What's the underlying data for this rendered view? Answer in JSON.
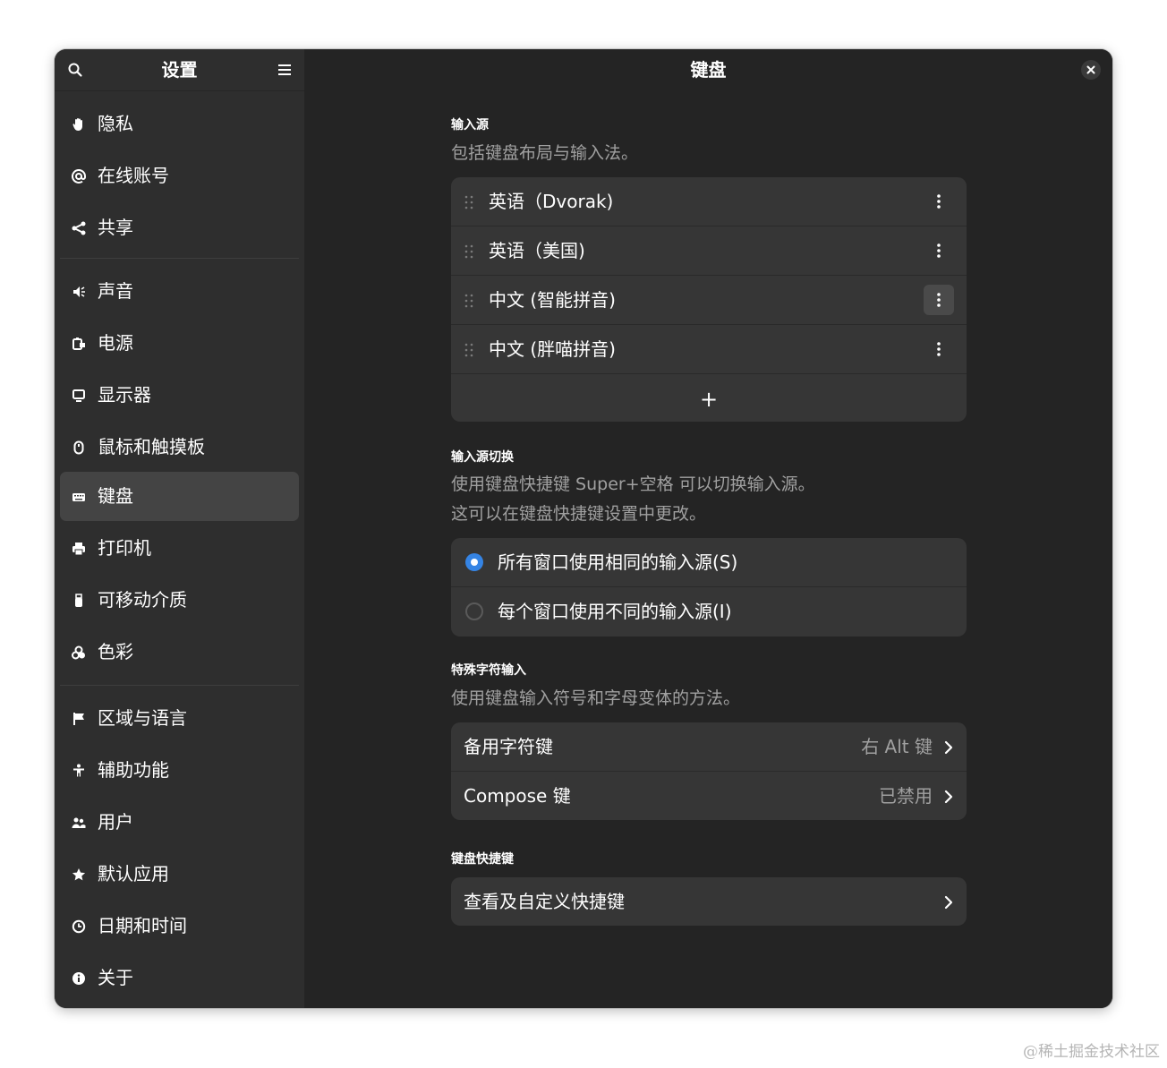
{
  "sidebar": {
    "title": "设置",
    "items": [
      {
        "label": "隐私",
        "icon": "hand-icon"
      },
      {
        "label": "在线账号",
        "icon": "at-icon"
      },
      {
        "label": "共享",
        "icon": "share-icon"
      },
      {
        "label": "声音",
        "icon": "speaker-icon"
      },
      {
        "label": "电源",
        "icon": "power-icon"
      },
      {
        "label": "显示器",
        "icon": "display-icon"
      },
      {
        "label": "鼠标和触摸板",
        "icon": "mouse-icon"
      },
      {
        "label": "键盘",
        "icon": "keyboard-icon",
        "selected": true
      },
      {
        "label": "打印机",
        "icon": "printer-icon"
      },
      {
        "label": "可移动介质",
        "icon": "usb-icon"
      },
      {
        "label": "色彩",
        "icon": "color-icon"
      },
      {
        "label": "区域与语言",
        "icon": "flag-icon"
      },
      {
        "label": "辅助功能",
        "icon": "accessibility-icon"
      },
      {
        "label": "用户",
        "icon": "users-icon"
      },
      {
        "label": "默认应用",
        "icon": "star-icon"
      },
      {
        "label": "日期和时间",
        "icon": "clock-icon"
      },
      {
        "label": "关于",
        "icon": "info-icon"
      }
    ]
  },
  "main": {
    "title": "键盘",
    "input_sources": {
      "title": "输入源",
      "description": "包括键盘布局与输入法。",
      "items": [
        "英语（Dvorak)",
        "英语（美国)",
        "中文 (智能拼音)",
        "中文 (胖喵拼音)"
      ],
      "add_label": "+"
    },
    "switching": {
      "title": "输入源切换",
      "description_line1": "使用键盘快捷键 Super+空格 可以切换输入源。",
      "description_line2": "这可以在键盘快捷键设置中更改。",
      "options": [
        "所有窗口使用相同的输入源(S)",
        "每个窗口使用不同的输入源(I)"
      ],
      "selected_index": 0
    },
    "special_chars": {
      "title": "特殊字符输入",
      "description": "使用键盘输入符号和字母变体的方法。",
      "rows": [
        {
          "label": "备用字符键",
          "value": "右 Alt 键"
        },
        {
          "label": "Compose 键",
          "value": "已禁用"
        }
      ]
    },
    "shortcuts": {
      "title": "键盘快捷键",
      "row_label": "查看及自定义快捷键"
    }
  },
  "watermark": "@稀土掘金技术社区",
  "colors": {
    "accent": "#3584e4",
    "sidebar": "#2e2e2e",
    "content": "#242424",
    "card": "#363636"
  }
}
